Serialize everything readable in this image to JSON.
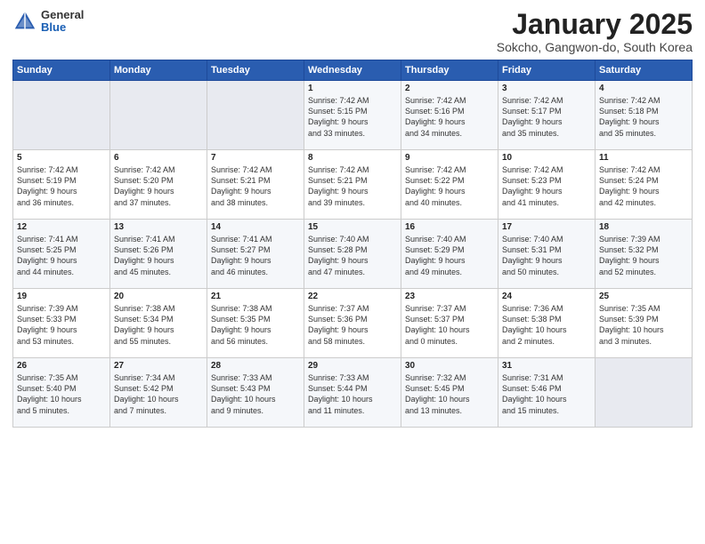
{
  "logo": {
    "general": "General",
    "blue": "Blue"
  },
  "title": "January 2025",
  "subtitle": "Sokcho, Gangwon-do, South Korea",
  "days_header": [
    "Sunday",
    "Monday",
    "Tuesday",
    "Wednesday",
    "Thursday",
    "Friday",
    "Saturday"
  ],
  "weeks": [
    [
      {
        "day": "",
        "text": ""
      },
      {
        "day": "",
        "text": ""
      },
      {
        "day": "",
        "text": ""
      },
      {
        "day": "1",
        "text": "Sunrise: 7:42 AM\nSunset: 5:15 PM\nDaylight: 9 hours\nand 33 minutes."
      },
      {
        "day": "2",
        "text": "Sunrise: 7:42 AM\nSunset: 5:16 PM\nDaylight: 9 hours\nand 34 minutes."
      },
      {
        "day": "3",
        "text": "Sunrise: 7:42 AM\nSunset: 5:17 PM\nDaylight: 9 hours\nand 35 minutes."
      },
      {
        "day": "4",
        "text": "Sunrise: 7:42 AM\nSunset: 5:18 PM\nDaylight: 9 hours\nand 35 minutes."
      }
    ],
    [
      {
        "day": "5",
        "text": "Sunrise: 7:42 AM\nSunset: 5:19 PM\nDaylight: 9 hours\nand 36 minutes."
      },
      {
        "day": "6",
        "text": "Sunrise: 7:42 AM\nSunset: 5:20 PM\nDaylight: 9 hours\nand 37 minutes."
      },
      {
        "day": "7",
        "text": "Sunrise: 7:42 AM\nSunset: 5:21 PM\nDaylight: 9 hours\nand 38 minutes."
      },
      {
        "day": "8",
        "text": "Sunrise: 7:42 AM\nSunset: 5:21 PM\nDaylight: 9 hours\nand 39 minutes."
      },
      {
        "day": "9",
        "text": "Sunrise: 7:42 AM\nSunset: 5:22 PM\nDaylight: 9 hours\nand 40 minutes."
      },
      {
        "day": "10",
        "text": "Sunrise: 7:42 AM\nSunset: 5:23 PM\nDaylight: 9 hours\nand 41 minutes."
      },
      {
        "day": "11",
        "text": "Sunrise: 7:42 AM\nSunset: 5:24 PM\nDaylight: 9 hours\nand 42 minutes."
      }
    ],
    [
      {
        "day": "12",
        "text": "Sunrise: 7:41 AM\nSunset: 5:25 PM\nDaylight: 9 hours\nand 44 minutes."
      },
      {
        "day": "13",
        "text": "Sunrise: 7:41 AM\nSunset: 5:26 PM\nDaylight: 9 hours\nand 45 minutes."
      },
      {
        "day": "14",
        "text": "Sunrise: 7:41 AM\nSunset: 5:27 PM\nDaylight: 9 hours\nand 46 minutes."
      },
      {
        "day": "15",
        "text": "Sunrise: 7:40 AM\nSunset: 5:28 PM\nDaylight: 9 hours\nand 47 minutes."
      },
      {
        "day": "16",
        "text": "Sunrise: 7:40 AM\nSunset: 5:29 PM\nDaylight: 9 hours\nand 49 minutes."
      },
      {
        "day": "17",
        "text": "Sunrise: 7:40 AM\nSunset: 5:31 PM\nDaylight: 9 hours\nand 50 minutes."
      },
      {
        "day": "18",
        "text": "Sunrise: 7:39 AM\nSunset: 5:32 PM\nDaylight: 9 hours\nand 52 minutes."
      }
    ],
    [
      {
        "day": "19",
        "text": "Sunrise: 7:39 AM\nSunset: 5:33 PM\nDaylight: 9 hours\nand 53 minutes."
      },
      {
        "day": "20",
        "text": "Sunrise: 7:38 AM\nSunset: 5:34 PM\nDaylight: 9 hours\nand 55 minutes."
      },
      {
        "day": "21",
        "text": "Sunrise: 7:38 AM\nSunset: 5:35 PM\nDaylight: 9 hours\nand 56 minutes."
      },
      {
        "day": "22",
        "text": "Sunrise: 7:37 AM\nSunset: 5:36 PM\nDaylight: 9 hours\nand 58 minutes."
      },
      {
        "day": "23",
        "text": "Sunrise: 7:37 AM\nSunset: 5:37 PM\nDaylight: 10 hours\nand 0 minutes."
      },
      {
        "day": "24",
        "text": "Sunrise: 7:36 AM\nSunset: 5:38 PM\nDaylight: 10 hours\nand 2 minutes."
      },
      {
        "day": "25",
        "text": "Sunrise: 7:35 AM\nSunset: 5:39 PM\nDaylight: 10 hours\nand 3 minutes."
      }
    ],
    [
      {
        "day": "26",
        "text": "Sunrise: 7:35 AM\nSunset: 5:40 PM\nDaylight: 10 hours\nand 5 minutes."
      },
      {
        "day": "27",
        "text": "Sunrise: 7:34 AM\nSunset: 5:42 PM\nDaylight: 10 hours\nand 7 minutes."
      },
      {
        "day": "28",
        "text": "Sunrise: 7:33 AM\nSunset: 5:43 PM\nDaylight: 10 hours\nand 9 minutes."
      },
      {
        "day": "29",
        "text": "Sunrise: 7:33 AM\nSunset: 5:44 PM\nDaylight: 10 hours\nand 11 minutes."
      },
      {
        "day": "30",
        "text": "Sunrise: 7:32 AM\nSunset: 5:45 PM\nDaylight: 10 hours\nand 13 minutes."
      },
      {
        "day": "31",
        "text": "Sunrise: 7:31 AM\nSunset: 5:46 PM\nDaylight: 10 hours\nand 15 minutes."
      },
      {
        "day": "",
        "text": ""
      }
    ]
  ]
}
